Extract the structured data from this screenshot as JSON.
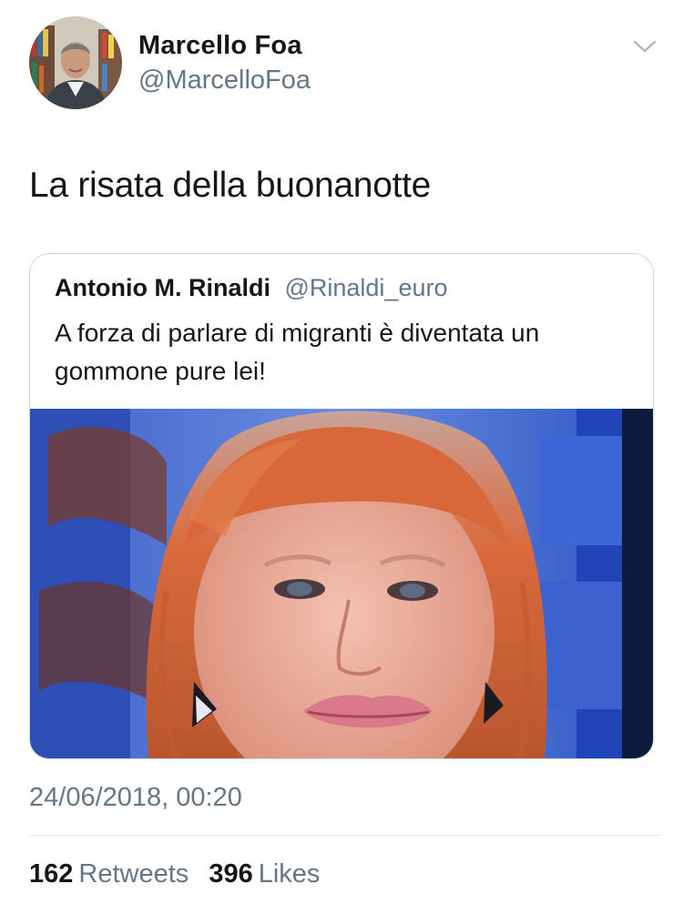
{
  "author": {
    "name": "Marcello Foa",
    "handle": "@MarcelloFoa"
  },
  "tweet": {
    "text": "La risata della buonanotte",
    "timestamp": "24/06/2018, 00:20"
  },
  "quoted_tweet": {
    "name": "Antonio M. Rinaldi",
    "handle": "@Rinaldi_euro",
    "text": "A forza di parlare di migranti è diventata un gommone pure lei!"
  },
  "stats": {
    "retweets_count": "162",
    "retweets_label": "Retweets",
    "likes_count": "396",
    "likes_label": "Likes"
  },
  "icons": {
    "menu": "chevron-down-icon"
  },
  "colors": {
    "text_primary": "#14171a",
    "text_secondary": "#657786",
    "border": "#ccd6dd",
    "divider": "#e1e8ed"
  }
}
